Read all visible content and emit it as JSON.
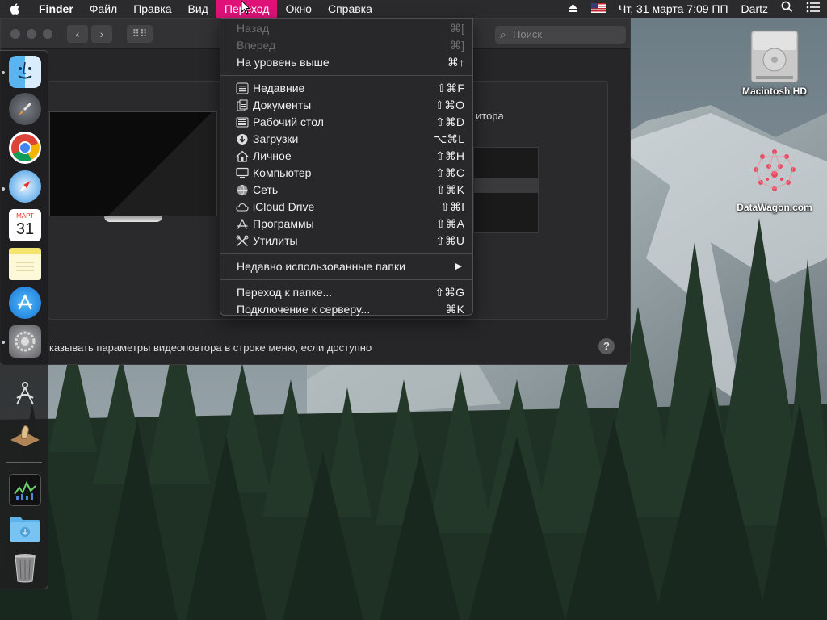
{
  "menubar": {
    "app": "Finder",
    "items": [
      "Файл",
      "Правка",
      "Вид",
      "Переход",
      "Окно",
      "Справка"
    ],
    "active": "Переход",
    "status": {
      "date_time": "Чт, 31 марта  7:09 ПП",
      "user": "Dartz"
    }
  },
  "window": {
    "search_placeholder": "Поиск",
    "pref_label_fragment": "итора",
    "checkbox_text": "казывать параметры видеоповтора в строке меню, если доступно",
    "help": "?"
  },
  "go_menu": {
    "items": [
      {
        "label": "Назад",
        "shortcut": "⌘[",
        "disabled": true,
        "icon": ""
      },
      {
        "label": "Вперед",
        "shortcut": "⌘]",
        "disabled": true,
        "icon": ""
      },
      {
        "label": "На уровень выше",
        "shortcut": "⌘↑",
        "disabled": false,
        "icon": ""
      },
      {
        "label": "Недавние",
        "shortcut": "⇧⌘F",
        "disabled": false,
        "icon": "recents-icon"
      },
      {
        "label": "Документы",
        "shortcut": "⇧⌘O",
        "disabled": false,
        "icon": "documents-icon"
      },
      {
        "label": "Рабочий стол",
        "shortcut": "⇧⌘D",
        "disabled": false,
        "icon": "desktop-icon"
      },
      {
        "label": "Загрузки",
        "shortcut": "⌥⌘L",
        "disabled": false,
        "icon": "downloads-icon"
      },
      {
        "label": "Личное",
        "shortcut": "⇧⌘H",
        "disabled": false,
        "icon": "home-icon"
      },
      {
        "label": "Компьютер",
        "shortcut": "⇧⌘C",
        "disabled": false,
        "icon": "computer-icon"
      },
      {
        "label": "Сеть",
        "shortcut": "⇧⌘K",
        "disabled": false,
        "icon": "network-icon"
      },
      {
        "label": "iCloud Drive",
        "shortcut": "⇧⌘I",
        "disabled": false,
        "icon": "icloud-icon"
      },
      {
        "label": "Программы",
        "shortcut": "⇧⌘A",
        "disabled": false,
        "icon": "applications-icon"
      },
      {
        "label": "Утилиты",
        "shortcut": "⇧⌘U",
        "disabled": false,
        "icon": "utilities-icon"
      },
      {
        "label": "Недавно использованные папки",
        "shortcut": "",
        "disabled": false,
        "icon": ""
      },
      {
        "label": "Переход к папке...",
        "shortcut": "⇧⌘G",
        "disabled": false,
        "icon": ""
      },
      {
        "label": "Подключение к серверу...",
        "shortcut": "⌘K",
        "disabled": false,
        "icon": ""
      }
    ]
  },
  "desktop_icons": [
    {
      "label": "Macintosh HD"
    },
    {
      "label": "DataWagon.com"
    }
  ],
  "dock": {
    "apps": [
      "finder-icon",
      "launchpad-icon",
      "chrome-icon",
      "safari-icon",
      "calendar-icon",
      "notes-icon",
      "app-store-icon",
      "system-preferences-icon",
      "grapher-icon",
      "chess-icon",
      "activity-monitor-icon",
      "downloads-folder-icon",
      "trash-icon"
    ],
    "calendar_month": "МАРТ",
    "calendar_day": "31"
  },
  "colors": {
    "menubar_bg": "#2b2b2d",
    "accent": "#e0127a",
    "menu_bg": "#28282a"
  }
}
